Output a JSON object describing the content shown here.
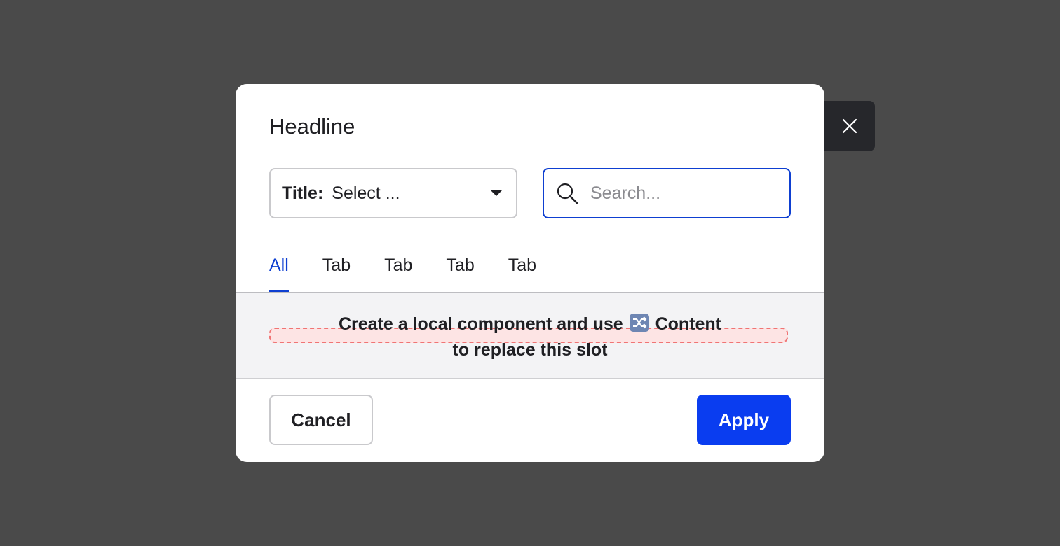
{
  "dialog": {
    "headline": "Headline",
    "select": {
      "label": "Title:",
      "value": "Select ..."
    },
    "search": {
      "placeholder": "Search...",
      "value": ""
    },
    "tabs": [
      {
        "label": "All",
        "active": true
      },
      {
        "label": "Tab",
        "active": false
      },
      {
        "label": "Tab",
        "active": false
      },
      {
        "label": "Tab",
        "active": false
      },
      {
        "label": "Tab",
        "active": false
      }
    ],
    "slot": {
      "line1_before": "Create a local component and use",
      "line1_after": "Content",
      "line2": "to replace this slot"
    },
    "footer": {
      "cancel_label": "Cancel",
      "apply_label": "Apply"
    }
  },
  "icons": {
    "close": "close-icon",
    "search": "search-icon",
    "caret": "caret-down-icon",
    "swap": "shuffle-icon"
  },
  "colors": {
    "accent": "#0e3fd1",
    "primary_button": "#0a3df0",
    "backdrop": "#4a4a4a",
    "close_button_bg": "#26272b",
    "slot_border": "#f07474",
    "content_bg": "#f3f3f5"
  }
}
